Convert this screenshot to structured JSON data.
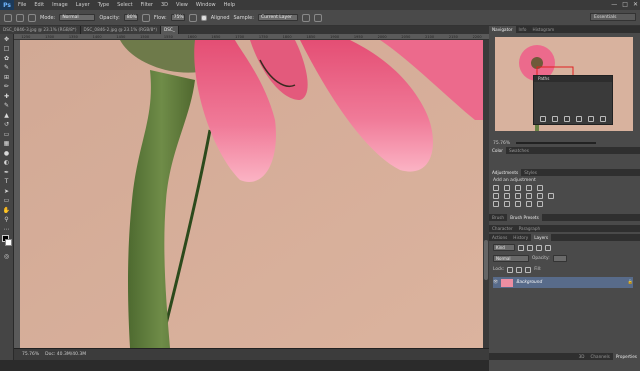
{
  "app": {
    "logo": "Ps"
  },
  "menu": [
    "File",
    "Edit",
    "Image",
    "Layer",
    "Type",
    "Select",
    "Filter",
    "3D",
    "View",
    "Window",
    "Help"
  ],
  "options": {
    "mode_label": "Mode:",
    "mode_value": "Normal",
    "opacity_label": "Opacity:",
    "opacity_value": "80%",
    "flow_label": "Flow:",
    "flow_value": "75%",
    "aligned_label": "Aligned",
    "sample_label": "Sample:",
    "sample_value": "Current Layer"
  },
  "workspace": "Essentials",
  "doc_tabs": [
    "DSC_0846-3.jpg @ 23.1% (RGB/8*)",
    "DSC_0846-2.jpg @ 23.1% (RGB/8*)",
    "DSC_"
  ],
  "ruler_marks": [
    "1250",
    "1300",
    "1350",
    "1400",
    "1450",
    "1500",
    "1550",
    "1600",
    "1650",
    "1700",
    "1750",
    "1800",
    "1850",
    "1900",
    "1950",
    "2000",
    "2050",
    "2100",
    "2150",
    "2200"
  ],
  "status": {
    "zoom": "75.76%",
    "doc": "Doc: 40.3M/40.3M"
  },
  "panels": {
    "navigator_tabs": [
      "Navigator",
      "Info",
      "Histogram"
    ],
    "nav_zoom": "75.76%",
    "paths_title": "Paths",
    "color_tabs": [
      "Color",
      "Swatches"
    ],
    "adjust_tabs": [
      "Adjustments",
      "Styles"
    ],
    "adjust_heading": "Add an adjustment",
    "brush_tabs": [
      "Brush",
      "Brush Presets"
    ],
    "char_tabs": [
      "Character",
      "Paragraph"
    ],
    "layers_tabs": [
      "Actions",
      "History",
      "Layers"
    ],
    "layer_kind": "Kind",
    "blend_mode": "Normal",
    "opacity_label": "Opacity:",
    "opacity_value": "",
    "lock_label": "Lock:",
    "fill_label": "Fill:",
    "layer_name": "Background",
    "bottom_tabs": [
      "3D",
      "Channels",
      "Properties"
    ]
  },
  "colors": {
    "accent": "#1c3a5a",
    "bg_flower": "#d6ad98",
    "petal": "#f07a98",
    "stem": "#5e7a3c"
  }
}
